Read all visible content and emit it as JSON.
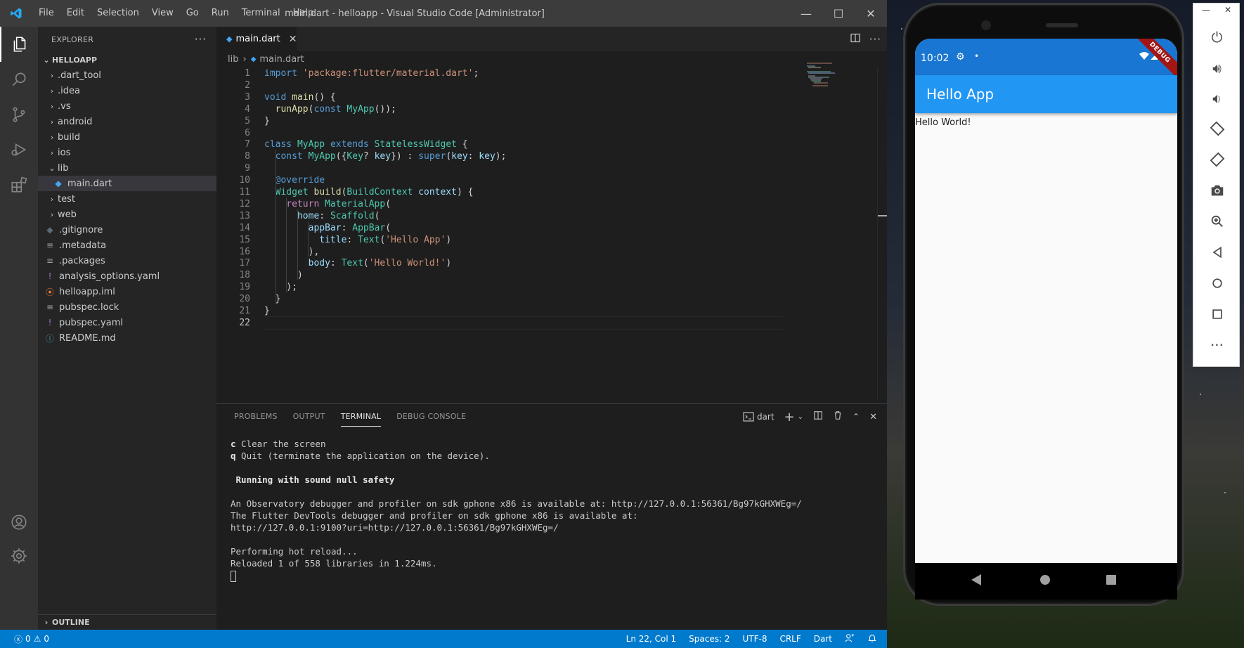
{
  "window": {
    "title": "main.dart - helloapp - Visual Studio Code [Administrator]",
    "menu": [
      "File",
      "Edit",
      "Selection",
      "View",
      "Go",
      "Run",
      "Terminal",
      "Help"
    ],
    "minimize": "—",
    "maximize": "☐",
    "close": "✕"
  },
  "explorer": {
    "title": "EXPLORER",
    "more": "···",
    "project": "HELLOAPP",
    "items": [
      {
        "label": ".dart_tool",
        "type": "folder",
        "expanded": false
      },
      {
        "label": ".idea",
        "type": "folder",
        "expanded": false
      },
      {
        "label": ".vs",
        "type": "folder",
        "expanded": false
      },
      {
        "label": "android",
        "type": "folder",
        "expanded": false
      },
      {
        "label": "build",
        "type": "folder",
        "expanded": false
      },
      {
        "label": "ios",
        "type": "folder",
        "expanded": false
      },
      {
        "label": "lib",
        "type": "folder",
        "expanded": true
      },
      {
        "label": "main.dart",
        "type": "dart",
        "selected": true
      },
      {
        "label": "test",
        "type": "folder",
        "expanded": false
      },
      {
        "label": "web",
        "type": "folder",
        "expanded": false
      },
      {
        "label": ".gitignore",
        "type": "git"
      },
      {
        "label": ".metadata",
        "type": "lines"
      },
      {
        "label": ".packages",
        "type": "lines"
      },
      {
        "label": "analysis_options.yaml",
        "type": "yaml"
      },
      {
        "label": "helloapp.iml",
        "type": "rss"
      },
      {
        "label": "pubspec.lock",
        "type": "lines"
      },
      {
        "label": "pubspec.yaml",
        "type": "yaml"
      },
      {
        "label": "README.md",
        "type": "info"
      }
    ],
    "outline": "OUTLINE"
  },
  "editor": {
    "tab_label": "main.dart",
    "tab_close": "✕",
    "breadcrumb_folder": "lib",
    "breadcrumb_file": "main.dart",
    "current_line": 22,
    "lines": [
      "import 'package:flutter/material.dart';",
      "",
      "void main() {",
      "  runApp(const MyApp());",
      "}",
      "",
      "class MyApp extends StatelessWidget {",
      "  const MyApp({Key? key}) : super(key: key);",
      "",
      "  @override",
      "  Widget build(BuildContext context) {",
      "    return MaterialApp(",
      "      home: Scaffold(",
      "        appBar: AppBar(",
      "          title: Text('Hello App')",
      "        ),",
      "        body: Text('Hello World!')",
      "      )",
      "    );",
      "  }",
      "}",
      ""
    ]
  },
  "panel": {
    "tabs": [
      "PROBLEMS",
      "OUTPUT",
      "TERMINAL",
      "DEBUG CONSOLE"
    ],
    "active_tab": "TERMINAL",
    "terminal_name": "dart",
    "terminal_lines": [
      {
        "key": "c",
        "text": " Clear the screen"
      },
      {
        "key": "q",
        "text": " Quit (terminate the application on the device)."
      },
      {
        "text": ""
      },
      {
        "bold": " Running with sound null safety"
      },
      {
        "text": ""
      },
      {
        "text": "An Observatory debugger and profiler on sdk gphone x86 is available at: http://127.0.0.1:56361/Bg97kGHXWEg=/"
      },
      {
        "text": "The Flutter DevTools debugger and profiler on sdk gphone x86 is available at:"
      },
      {
        "text": "http://127.0.0.1:9100?uri=http://127.0.0.1:56361/Bg97kGHXWEg=/"
      },
      {
        "text": ""
      },
      {
        "text": "Performing hot reload..."
      },
      {
        "text": "Reloaded 1 of 558 libraries in 1.224ms."
      }
    ]
  },
  "statusbar": {
    "errors": "0",
    "warnings": "0",
    "position": "Ln 22, Col 1",
    "spaces": "Spaces: 2",
    "encoding": "UTF-8",
    "eol": "CRLF",
    "language": "Dart"
  },
  "phone": {
    "time": "10:02",
    "banner": "DEBUG",
    "app_title": "Hello App",
    "body_text": "Hello World!"
  },
  "emulator_toolbar": {
    "minimize": "—",
    "close": "✕",
    "buttons": [
      "power-icon",
      "volume-up-icon",
      "volume-down-icon",
      "rotate-left-icon",
      "rotate-right-icon",
      "camera-icon",
      "zoom-icon",
      "back-icon",
      "home-icon",
      "overview-icon",
      "more-icon"
    ]
  },
  "colors": {
    "accent": "#007acc",
    "app_bar": "#2196f3",
    "phone_status_bar": "#1976d2",
    "editor_bg": "#1e1e1e"
  }
}
